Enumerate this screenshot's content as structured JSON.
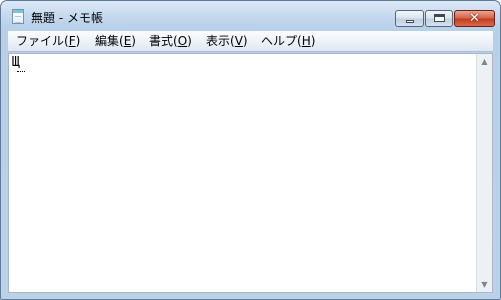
{
  "window": {
    "title": "無題 - メモ帳",
    "controls": {
      "minimize_glyph": "",
      "maximize_glyph": "",
      "close_glyph": "✕"
    }
  },
  "menu": {
    "items": [
      {
        "label": "ファイル(",
        "key": "F",
        "suffix": ")"
      },
      {
        "label": "編集(",
        "key": "E",
        "suffix": ")"
      },
      {
        "label": "書式(",
        "key": "O",
        "suffix": ")"
      },
      {
        "label": "表示(",
        "key": "V",
        "suffix": ")"
      },
      {
        "label": "ヘルプ(",
        "key": "H",
        "suffix": ")"
      }
    ]
  },
  "editor": {
    "content": "Щ"
  },
  "scrollbar": {
    "up_glyph": "▲",
    "down_glyph": "▼"
  },
  "icons": {
    "app": "notepad-icon"
  }
}
